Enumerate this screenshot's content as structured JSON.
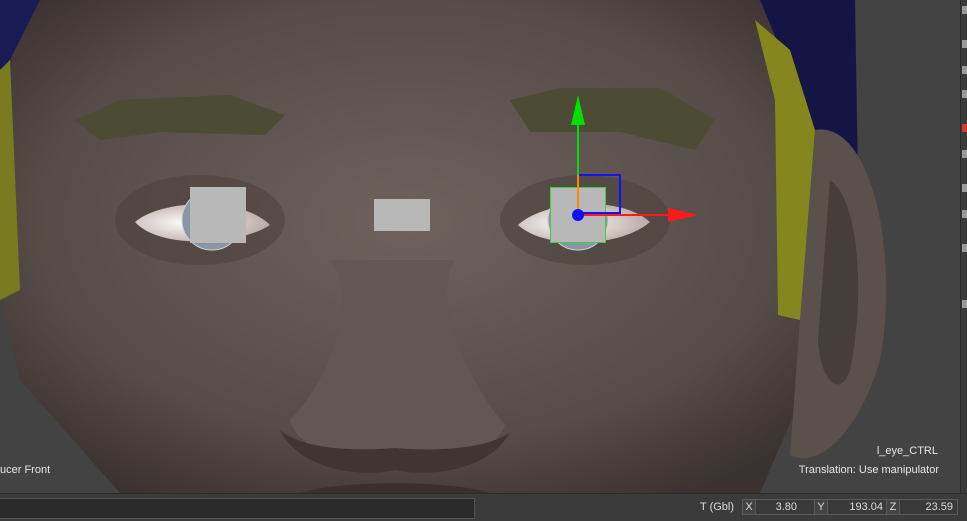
{
  "viewport": {
    "camera_label": "ucer Front",
    "selected_object": "l_eye_CTRL",
    "tool_hint": "Translation: Use manipulator"
  },
  "statusbar": {
    "command_value": "",
    "transform_mode": "T (Gbl)",
    "x_label": "X",
    "x_value": "3.80",
    "y_label": "Y",
    "y_value": "193.04",
    "z_label": "Z",
    "z_value": "23.59"
  },
  "colors": {
    "manipulator_y": "#00e000",
    "manipulator_x": "#ff1a1a",
    "manipulator_z": "#1010ff",
    "selection_outline": "#39d339"
  }
}
